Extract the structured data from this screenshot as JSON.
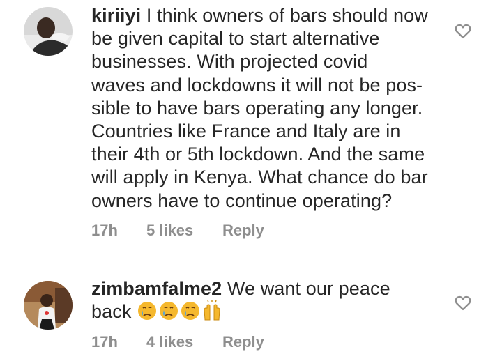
{
  "comments": [
    {
      "username": "kiriiyi",
      "text_lines": [
        " I think owners of bars should now",
        "be given capital to start alternative",
        "businesses. With projected covid",
        "waves and lockdowns it will not be pos-",
        "sible to have bars operating any longer.",
        "Countries like France and Italy are in",
        "their 4th or 5th lockdown. And the same",
        "will apply in Kenya. What chance do bar",
        "owners have to continue operating?"
      ],
      "time": "17h",
      "likes": "5 likes",
      "reply": "Reply"
    },
    {
      "username": "zimbamfalme2",
      "text_lines": [
        " We want our peace",
        "back"
      ],
      "emojis": [
        "crying-face",
        "crying-face",
        "crying-face",
        "raising-hands"
      ],
      "time": "17h",
      "likes": "4 likes",
      "reply": "Reply"
    }
  ],
  "colors": {
    "text": "#262626",
    "meta": "#8e8e8e",
    "emoji_face": "#f5b82e",
    "emoji_tear": "#4fa3e0"
  },
  "icons": {
    "like": "heart-outline-icon"
  }
}
